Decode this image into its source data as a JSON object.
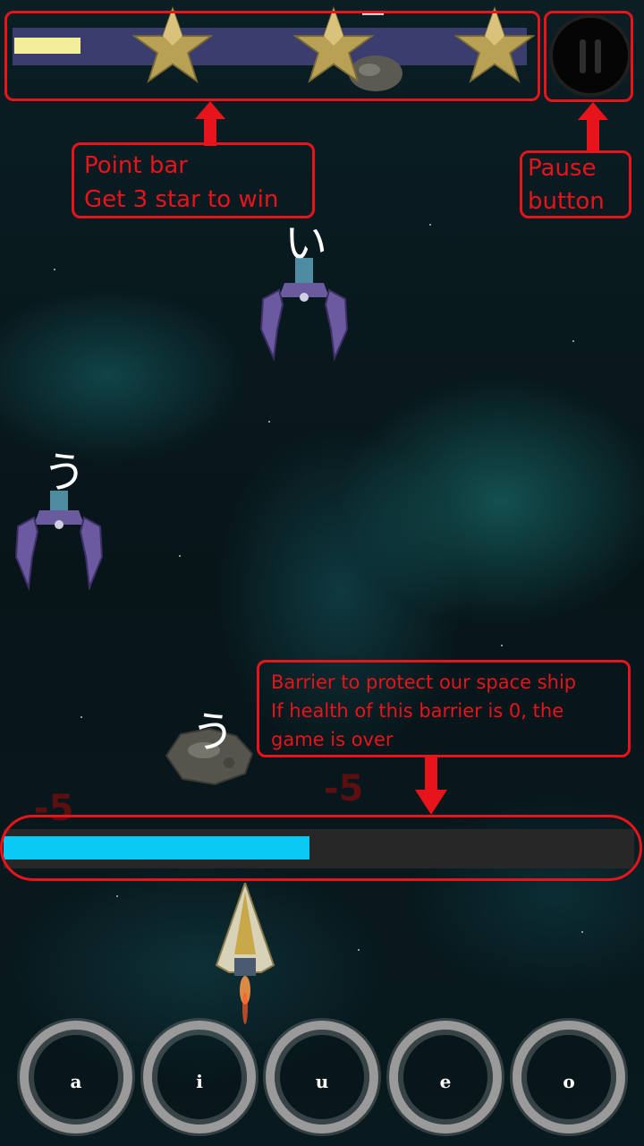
{
  "hud": {
    "point_bar": {
      "progress": 0.13,
      "stars": 3,
      "fill_color": "#f2ee9a",
      "track_color": "#3b3d6f"
    },
    "pause_icon": "pause-icon"
  },
  "annotations": {
    "point_bar_line1": "Point bar",
    "point_bar_line2": "Get 3 star to win",
    "pause_line1": "Pause",
    "pause_line2": "button",
    "barrier_line1": "Barrier to protect our space ship",
    "barrier_line2": "If health of this barrier is 0, the",
    "barrier_line3": "game is over"
  },
  "enemies": {
    "kana_1": "い",
    "kana_2": "う",
    "kana_3": "う",
    "kana_top": "ー"
  },
  "barrier": {
    "health_fraction": 0.485,
    "fill_color": "#0ac9f5"
  },
  "damage": {
    "left": "-5",
    "right": "-5"
  },
  "answers": [
    "a",
    "i",
    "u",
    "e",
    "o"
  ]
}
